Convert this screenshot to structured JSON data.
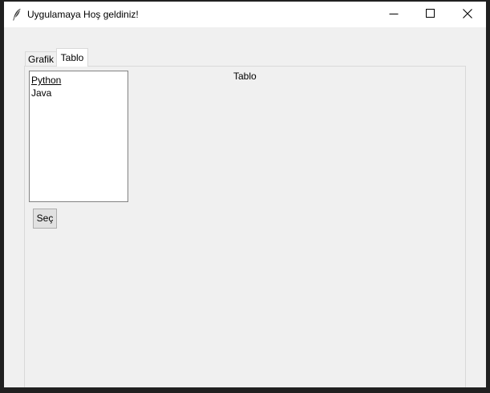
{
  "window": {
    "title": "Uygulamaya Hoş geldiniz!",
    "icon": "feather-icon",
    "controls": [
      "minimize-icon",
      "maximize-icon",
      "close-icon"
    ]
  },
  "tabs": [
    {
      "label": "Grafik",
      "selected": false
    },
    {
      "label": "Tablo",
      "selected": true
    }
  ],
  "panel": {
    "label": "Tablo",
    "listbox": {
      "items": [
        "Python",
        "Java"
      ],
      "active_item": "Python"
    },
    "button_label": "Seç"
  },
  "colors": {
    "window_bg": "#f0f0f0",
    "titlebar_bg": "#ffffff",
    "outer_frame": "#202020"
  }
}
